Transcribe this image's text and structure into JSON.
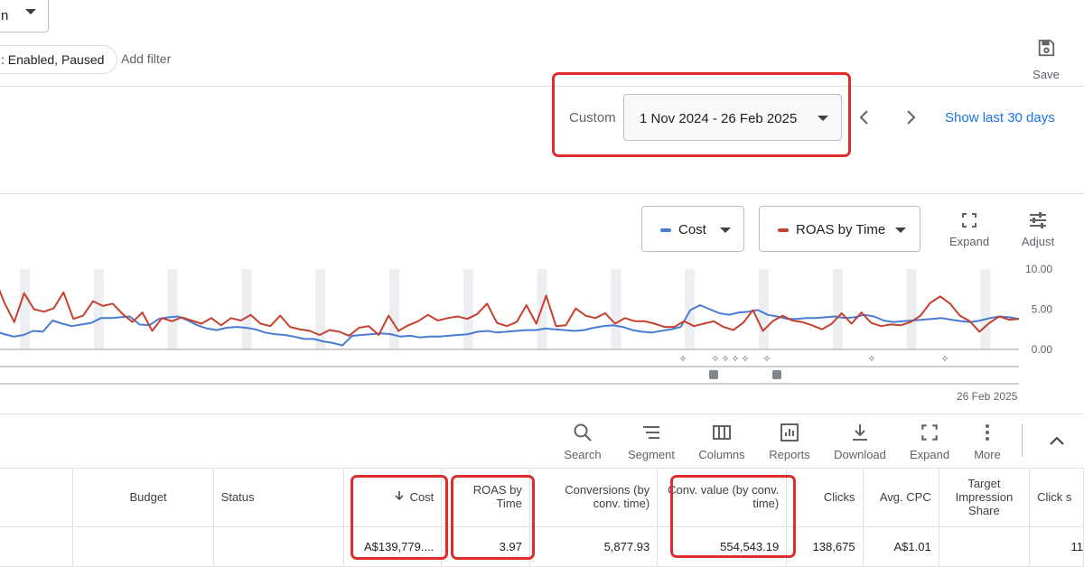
{
  "top": {
    "dropdown_value": "n",
    "filter_chip": ": Enabled, Paused",
    "add_filter": "Add filter",
    "save_label": "Save"
  },
  "date": {
    "range_type": "Custom",
    "range_value": "1 Nov 2024 - 26 Feb 2025",
    "show_last": "Show last 30 days"
  },
  "chart_controls": {
    "metric1": "Cost",
    "metric2": "ROAS by Time",
    "expand": "Expand",
    "adjust": "Adjust"
  },
  "colors": {
    "cost": "#4a7bd4",
    "roas": "#c5402e",
    "highlight": "#e02c2c",
    "link": "#1a73e8"
  },
  "chart_data": {
    "type": "line",
    "y_ticks": [
      "10.00",
      "5.00",
      "0.00"
    ],
    "ylim": [
      0,
      10
    ],
    "end_date_label": "26 Feb 2025",
    "series": [
      {
        "values": [
          2.3,
          1.9,
          1.6,
          1.8,
          2.3,
          2.2,
          3.6,
          3.2,
          2.9,
          3.1,
          3.3,
          3.9,
          3.9,
          4.0,
          4.1,
          3.1,
          3.0,
          3.8,
          4.0,
          4.1,
          3.6,
          3.0,
          2.6,
          2.4,
          2.7,
          2.8,
          2.7,
          2.5,
          2.1,
          1.9,
          1.8,
          1.6,
          1.3,
          1.3,
          1.0,
          0.8,
          0.5,
          1.7,
          1.8,
          1.9,
          2.0,
          1.9,
          1.6,
          1.7,
          1.5,
          1.6,
          1.6,
          1.7,
          1.8,
          1.9,
          2.2,
          2.3,
          2.1,
          2.2,
          2.3,
          2.4,
          2.4,
          2.6,
          2.5,
          2.4,
          2.3,
          2.4,
          2.7,
          2.9,
          3.0,
          2.8,
          2.4,
          2.2,
          2.1,
          2.3,
          2.5,
          2.8,
          4.9,
          5.5,
          5.0,
          4.5,
          4.3,
          4.6,
          4.7,
          4.9,
          4.3,
          4.1,
          3.8,
          3.8,
          3.9,
          3.9,
          4.0,
          4.1,
          3.9,
          4.0,
          4.3,
          4.1,
          3.6,
          3.4,
          3.5,
          3.6,
          3.7,
          3.8,
          3.9,
          3.7,
          3.5,
          3.4,
          3.6,
          3.9,
          4.1,
          4.0,
          3.8
        ]
      },
      {
        "values": [
          8.9,
          5.8,
          3.4,
          7.0,
          5.0,
          4.7,
          5.1,
          7.1,
          3.8,
          4.2,
          6.0,
          5.4,
          5.7,
          4.4,
          3.4,
          4.6,
          2.3,
          3.9,
          3.5,
          4.0,
          3.6,
          3.2,
          3.9,
          3.0,
          3.9,
          3.6,
          4.3,
          3.2,
          2.9,
          4.2,
          2.8,
          2.5,
          2.3,
          1.8,
          2.4,
          2.2,
          1.7,
          2.7,
          2.9,
          1.8,
          4.2,
          2.3,
          3.0,
          3.5,
          4.3,
          3.6,
          3.9,
          4.1,
          3.8,
          4.4,
          5.7,
          3.3,
          2.9,
          3.4,
          5.5,
          3.2,
          6.7,
          2.9,
          3.0,
          5.1,
          4.2,
          3.9,
          4.5,
          3.2,
          3.9,
          3.5,
          3.5,
          3.2,
          2.8,
          2.8,
          3.5,
          2.9,
          3.2,
          3.5,
          2.8,
          2.4,
          3.3,
          4.9,
          2.3,
          3.5,
          4.2,
          3.6,
          3.4,
          3.0,
          2.5,
          3.2,
          4.5,
          3.2,
          4.6,
          3.3,
          2.9,
          3.1,
          3.0,
          3.4,
          4.2,
          5.8,
          6.6,
          5.7,
          4.2,
          3.5,
          2.2,
          3.3,
          4.1,
          3.7,
          3.8
        ]
      }
    ]
  },
  "toolbar": {
    "search": "Search",
    "segment": "Segment",
    "columns": "Columns",
    "reports": "Reports",
    "download": "Download",
    "expand": "Expand",
    "more": "More"
  },
  "table": {
    "headers": {
      "budget": "Budget",
      "status": "Status",
      "cost": "Cost",
      "roas": "ROAS by Time",
      "conversions": "Conversions (by conv. time)",
      "conv_value": "Conv. value (by conv. time)",
      "clicks": "Clicks",
      "avg_cpc": "Avg. CPC",
      "target_impr": "Target Impression Share",
      "click_share": "Click s"
    },
    "row": {
      "cost": "A$139,779....",
      "roas": "3.97",
      "conversions": "5,877.93",
      "conv_value": "554,543.19",
      "clicks": "138,675",
      "avg_cpc": "A$1.01",
      "click_share": "11"
    }
  }
}
